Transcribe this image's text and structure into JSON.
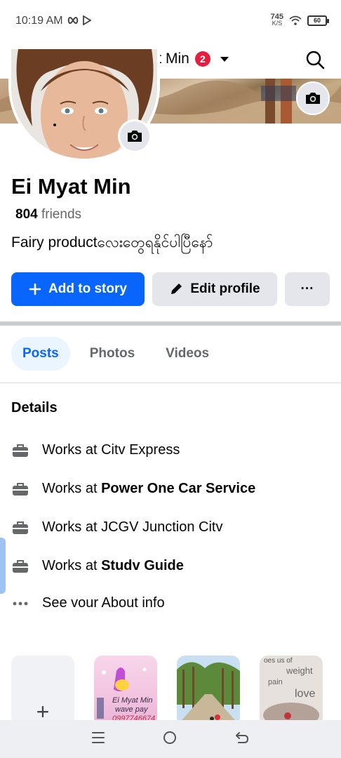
{
  "status_bar": {
    "time": "10:19 AM",
    "net_speed_value": "745",
    "net_speed_unit": "K/S",
    "battery": "60"
  },
  "topbar": {
    "title": "Ei Mvat Min",
    "badge_count": "2"
  },
  "profile": {
    "name": "Ei Myat Min",
    "friends_count": "804",
    "friends_label": " friends",
    "bio": "Fairy productလေးတွေရနိုင်ပါပြီနော်"
  },
  "actions": {
    "add_story": "Add to story",
    "edit_profile": "Edit profile",
    "more": "···"
  },
  "tabs": [
    {
      "label": "Posts",
      "active": true
    },
    {
      "label": "Photos",
      "active": false
    },
    {
      "label": "Videos",
      "active": false
    }
  ],
  "details": {
    "title": "Details",
    "items": [
      {
        "prefix": "Works at ",
        "place": "Citv Express",
        "bold": false
      },
      {
        "prefix": "Works at ",
        "place": "Power One Car Service",
        "bold": true
      },
      {
        "prefix": "Works at ",
        "place": "JCGV Junction Citv",
        "bold": false
      },
      {
        "prefix": "Works at ",
        "place": "Studv  Guide",
        "bold": true
      }
    ],
    "about_link": "See vour About info"
  },
  "photos": {
    "add_symbol": "+",
    "thumb1_line1": "Ei Myat Min",
    "thumb1_line2": "wave pay",
    "thumb1_line3": "0997746674",
    "thumb3_top": "oes us of",
    "thumb3_w": "weight",
    "thumb3_p": "pain",
    "thumb3_l": "love"
  },
  "colors": {
    "accent": "#0866ff",
    "badge": "#e41e3f",
    "tab_active_bg": "#ebf5ff"
  }
}
